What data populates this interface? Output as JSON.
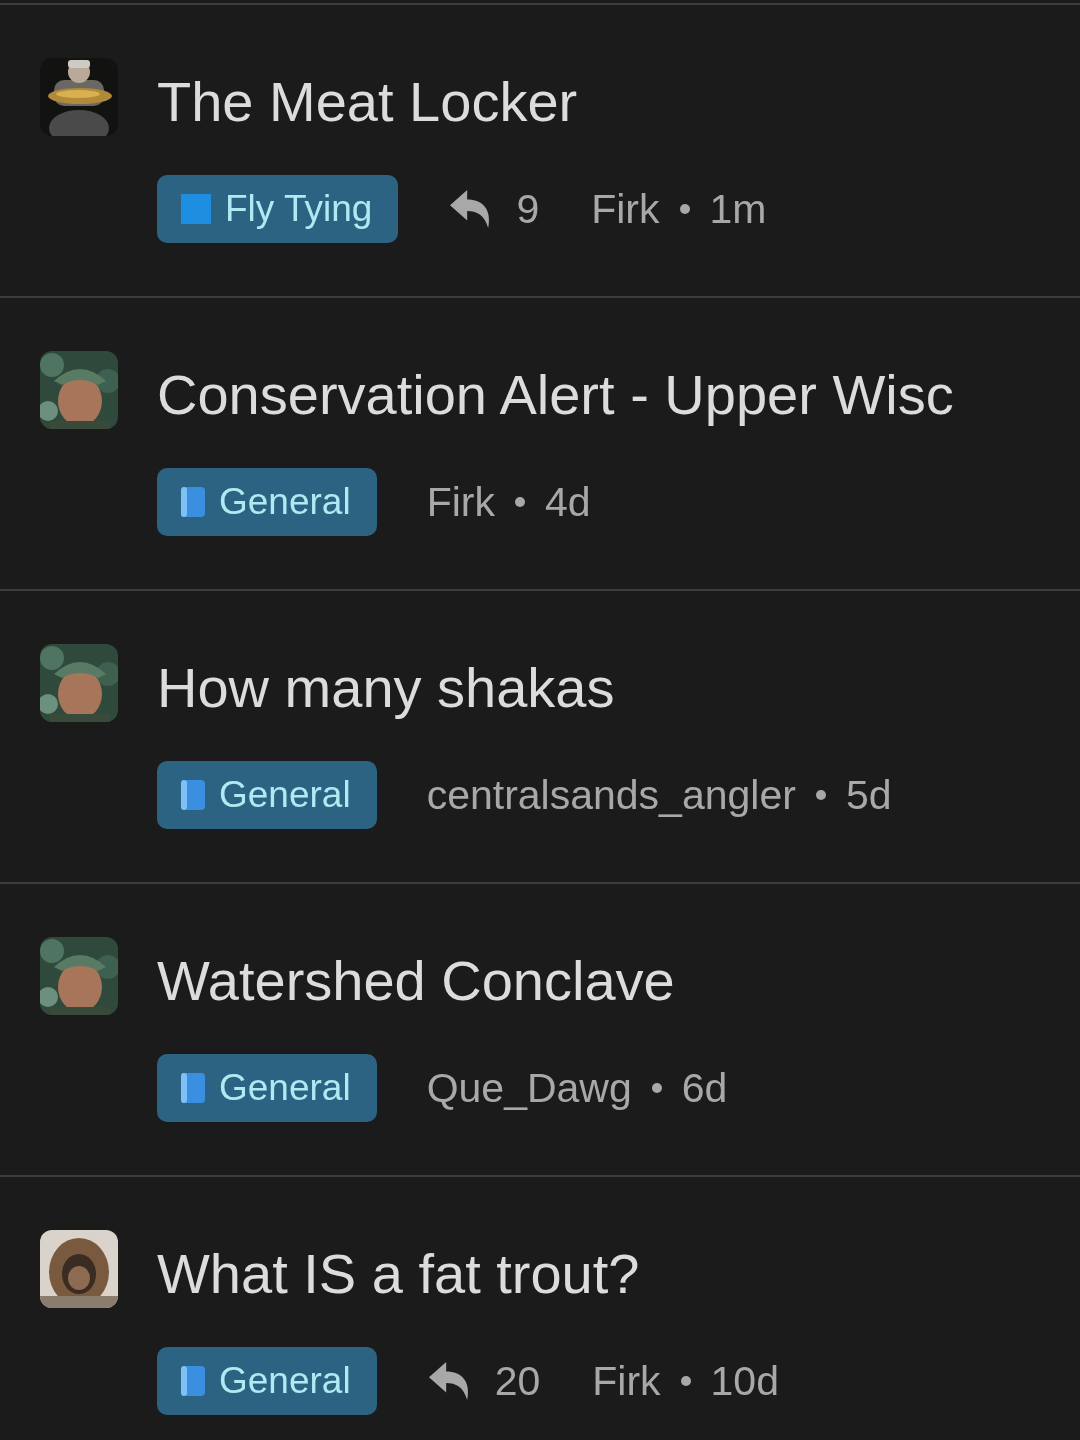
{
  "topics": [
    {
      "title": "The Meat Locker",
      "category": {
        "label": "Fly Tying",
        "kind": "square"
      },
      "replies": "9",
      "author": "Firk",
      "age": "1m"
    },
    {
      "title": "Conservation Alert - Upper Wisc",
      "category": {
        "label": "General",
        "kind": "book"
      },
      "author": "Firk",
      "age": "4d"
    },
    {
      "title": "How many shakas",
      "category": {
        "label": "General",
        "kind": "book"
      },
      "author": "centralsands_angler",
      "age": "5d"
    },
    {
      "title": "Watershed Conclave",
      "category": {
        "label": "General",
        "kind": "book"
      },
      "author": "Que_Dawg",
      "age": "6d"
    },
    {
      "title": "What IS a fat trout?",
      "category": {
        "label": "General",
        "kind": "book"
      },
      "replies": "20",
      "author": "Firk",
      "age": "10d"
    }
  ]
}
